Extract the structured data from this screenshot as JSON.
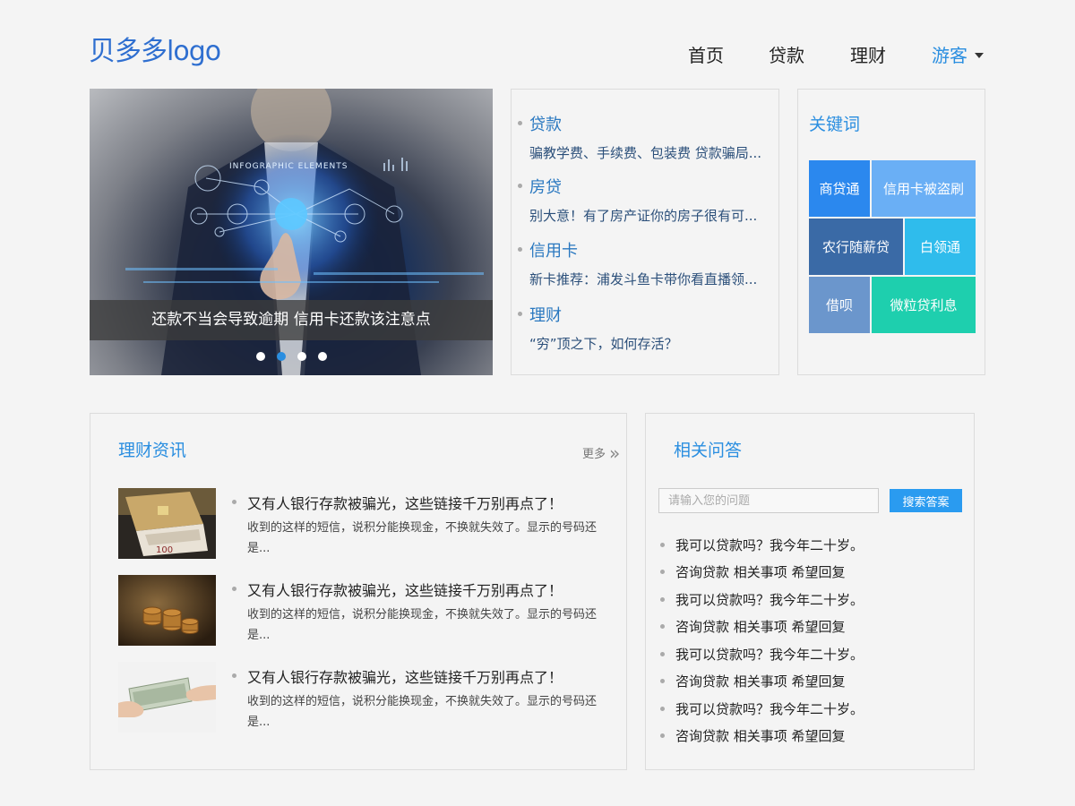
{
  "header": {
    "logo": "贝多多logo",
    "nav": [
      "首页",
      "贷款",
      "理财"
    ],
    "user": "游客"
  },
  "banner": {
    "caption": "还款不当会导致逾期 信用卡还款该注意点",
    "graphic_text": "INFOGRAPHIC ELEMENTS",
    "dot_count": 4,
    "active_dot": 1
  },
  "news": [
    {
      "category": "贷款",
      "headline": "骗教学费、手续费、包装费 贷款骗局大起底"
    },
    {
      "category": "房贷",
      "headline": "别大意！有了房产证你的房子很有可能不是你的"
    },
    {
      "category": "信用卡",
      "headline": "新卡推荐：浦发斗鱼卡带你看直播领福利"
    },
    {
      "category": "理财",
      "headline": "“穷”顶之下，如何存活？"
    }
  ],
  "keywords": {
    "title": "关键词",
    "tiles": [
      {
        "label": "商贷通",
        "color": "#2b88ee"
      },
      {
        "label": "信用卡被盗刷",
        "color": "#6aaff5"
      },
      {
        "label": "农行随薪贷",
        "color": "#3a6aa6"
      },
      {
        "label": "白领通",
        "color": "#2fbcec"
      },
      {
        "label": "借呗",
        "color": "#6b96cc"
      },
      {
        "label": "微粒贷利息",
        "color": "#1ecfae"
      }
    ]
  },
  "finance": {
    "title": "理财资讯",
    "more": "更多",
    "articles": [
      {
        "title": "又有人银行存款被骗光，这些链接千万别再点了！",
        "desc": "收到的这样的短信，说积分能换现金，不换就失效了。显示的号码还是..."
      },
      {
        "title": "又有人银行存款被骗光，这些链接千万别再点了！",
        "desc": "收到的这样的短信，说积分能换现金，不换就失效了。显示的号码还是..."
      },
      {
        "title": "又有人银行存款被骗光，这些链接千万别再点了！",
        "desc": "收到的这样的短信，说积分能换现金，不换就失效了。显示的号码还是..."
      }
    ]
  },
  "qa": {
    "title": "相关问答",
    "placeholder": "请输入您的问题",
    "button": "搜索答案",
    "items": [
      "我可以贷款吗？我今年二十岁。",
      "咨询贷款 相关事项 希望回复",
      "我可以贷款吗？我今年二十岁。",
      "咨询贷款 相关事项 希望回复",
      "我可以贷款吗？我今年二十岁。",
      "咨询贷款 相关事项 希望回复",
      "我可以贷款吗？我今年二十岁。",
      "咨询贷款 相关事项 希望回复"
    ]
  },
  "colors": {
    "accent": "#2a8ee0",
    "logo": "#2f6fd0"
  }
}
